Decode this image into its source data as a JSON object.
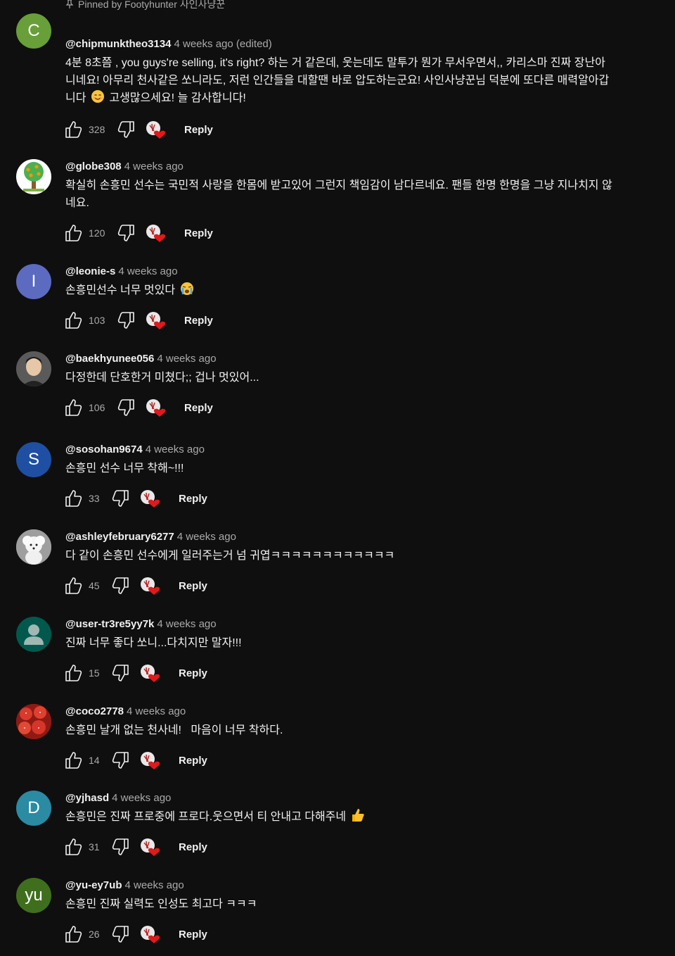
{
  "pinned_label": "Pinned by Footyhunter 사인사냥꾼",
  "reply_label": "Reply",
  "comments": [
    {
      "avatar_letter": "C",
      "avatar_color": "#689f38",
      "handle": "@chipmunktheo3134",
      "date": "4 weeks ago (edited)",
      "text_lines": [
        "4분 8초쯤 , you guys're selling, it's right? 하는 거 같은데, 웃는데도 말투가 뭔가 무서우면서,, 카리스마 진짜 장난아",
        "니네요! 아무리 천사같은 쏘니라도, 저런 인간들을 대할땐 바로 압도하는군요! 사인사냥꾼님 덕분에 또다른 매력알아갑",
        "니다",
        "고생많으세요! 늘 감사합니다!"
      ],
      "likes": "328"
    },
    {
      "avatar_letter": "",
      "avatar_color": "#ffffff",
      "avatar_icon": "tree-avatar-icon",
      "handle": "@globe308",
      "date": "4 weeks ago",
      "text_lines": [
        "확실히 손흥민 선수는 국민적 사랑을 한몸에 받고있어 그런지 책임감이 남다르네요. 팬들 한명 한명을 그냥 지나치지 않",
        "네요."
      ],
      "likes": "120"
    },
    {
      "avatar_letter": "I",
      "avatar_color": "#5c6bc0",
      "handle": "@leonie-s",
      "date": "4 weeks ago",
      "text_lines": [
        "손흥민선수 너무 멋있다"
      ],
      "likes": "103"
    },
    {
      "avatar_letter": "",
      "avatar_color": "#3a3a3a",
      "avatar_icon": "person-photo-avatar-icon",
      "handle": "@baekhyunee056",
      "date": "4 weeks ago",
      "text_lines": [
        "다정한데 단호한거 미쳤다;; 겁나 멋있어..."
      ],
      "likes": "106"
    },
    {
      "avatar_letter": "S",
      "avatar_color": "#1e4fa3",
      "handle": "@sosohan9674",
      "date": "4 weeks ago",
      "text_lines": [
        "손흥민 선수 너무 착해~!!!"
      ],
      "likes": "33"
    },
    {
      "avatar_letter": "",
      "avatar_color": "#cfcfcf",
      "avatar_icon": "white-dog-avatar-icon",
      "handle": "@ashleyfebruary6277",
      "date": "4 weeks ago",
      "text_lines": [
        "다 같이 손흥민 선수에게 일러주는거 넘 귀엽ㅋㅋㅋㅋㅋㅋㅋㅋㅋㅋㅋㅋ"
      ],
      "likes": "45"
    },
    {
      "avatar_letter": "",
      "avatar_color": "#00594c",
      "avatar_icon": "default-user-avatar-icon",
      "handle": "@user-tr3re5yy7k",
      "date": "4 weeks ago",
      "text_lines": [
        "진짜 너무 좋다 쏘니...다치지만 말자!!!"
      ],
      "likes": "15"
    },
    {
      "avatar_letter": "",
      "avatar_color": "#b3261e",
      "avatar_icon": "strawberries-avatar-icon",
      "handle": "@coco2778",
      "date": "4 weeks ago",
      "text_lines": [
        "손흥민 날개 없는 천사네!   마음이 너무 착하다."
      ],
      "likes": "14"
    },
    {
      "avatar_letter": "D",
      "avatar_color": "#2a8ba3",
      "handle": "@yjhasd",
      "date": "4 weeks ago",
      "text_lines": [
        "손흥민은 진짜 프로중에 프로다.웃으면서 티 안내고 다해주네"
      ],
      "likes": "31"
    },
    {
      "avatar_letter": "yu",
      "avatar_color": "#3f6f1c",
      "handle": "@yu-ey7ub",
      "date": "4 weeks ago",
      "text_lines": [
        "손흥민 진짜 실력도 인성도 최고다 ㅋㅋㅋ"
      ],
      "likes": "26"
    }
  ]
}
